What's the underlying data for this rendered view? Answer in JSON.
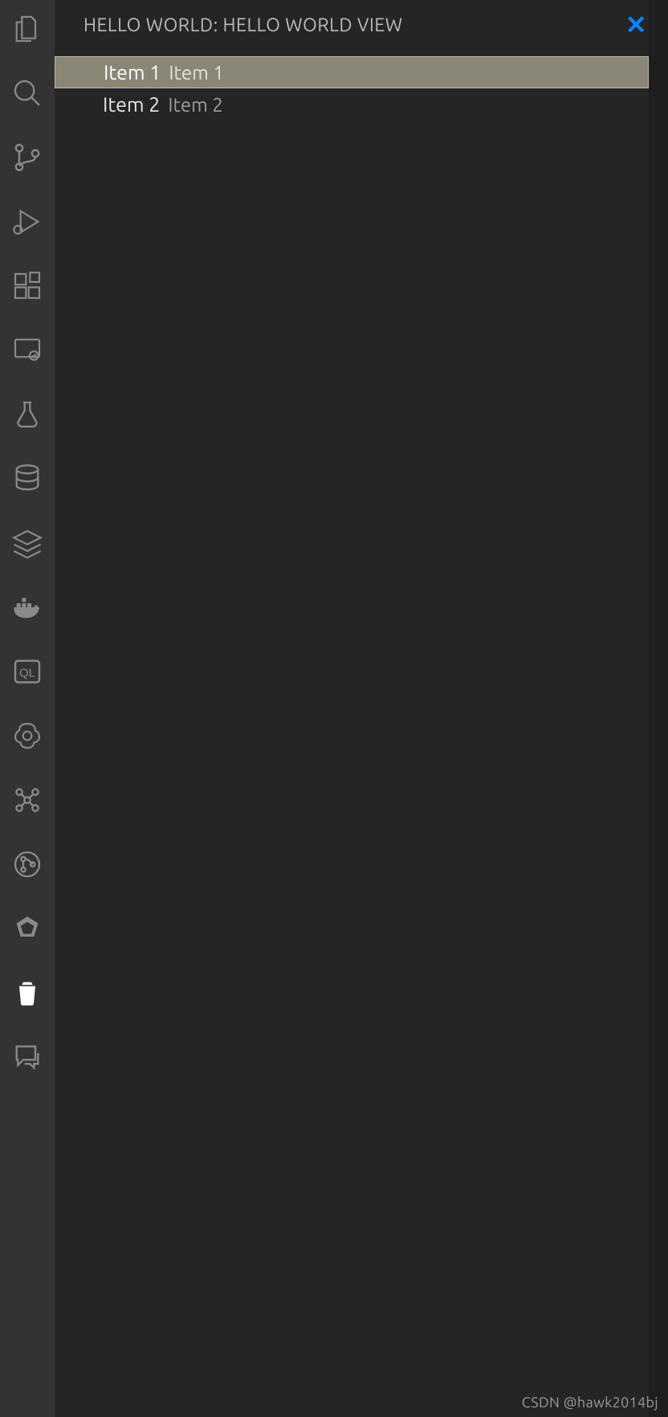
{
  "activitybar": {
    "items": [
      {
        "name": "explorer-icon"
      },
      {
        "name": "search-icon"
      },
      {
        "name": "source-control-icon"
      },
      {
        "name": "run-debug-icon"
      },
      {
        "name": "extensions-icon"
      },
      {
        "name": "remote-explorer-icon"
      },
      {
        "name": "testing-icon"
      },
      {
        "name": "database-icon"
      },
      {
        "name": "layers-icon"
      },
      {
        "name": "docker-icon"
      },
      {
        "name": "graphql-icon"
      },
      {
        "name": "openai-icon"
      },
      {
        "name": "graph-icon"
      },
      {
        "name": "git-graph-icon"
      },
      {
        "name": "polygon-icon"
      },
      {
        "name": "trash-icon"
      },
      {
        "name": "comments-icon"
      }
    ],
    "active_index": 15
  },
  "sidebar": {
    "title": "HELLO WORLD: HELLO WORLD VIEW",
    "close_glyph": "✕",
    "tree": [
      {
        "label": "Item 1",
        "description": "Item 1",
        "selected": true
      },
      {
        "label": "Item 2",
        "description": "Item 2",
        "selected": false
      }
    ]
  },
  "watermark": "CSDN @hawk2014bj",
  "colors": {
    "accent": "#0a84ff",
    "activitybar_bg": "#333333",
    "sidebar_bg": "#252526",
    "selected_row": "#8a8675"
  }
}
